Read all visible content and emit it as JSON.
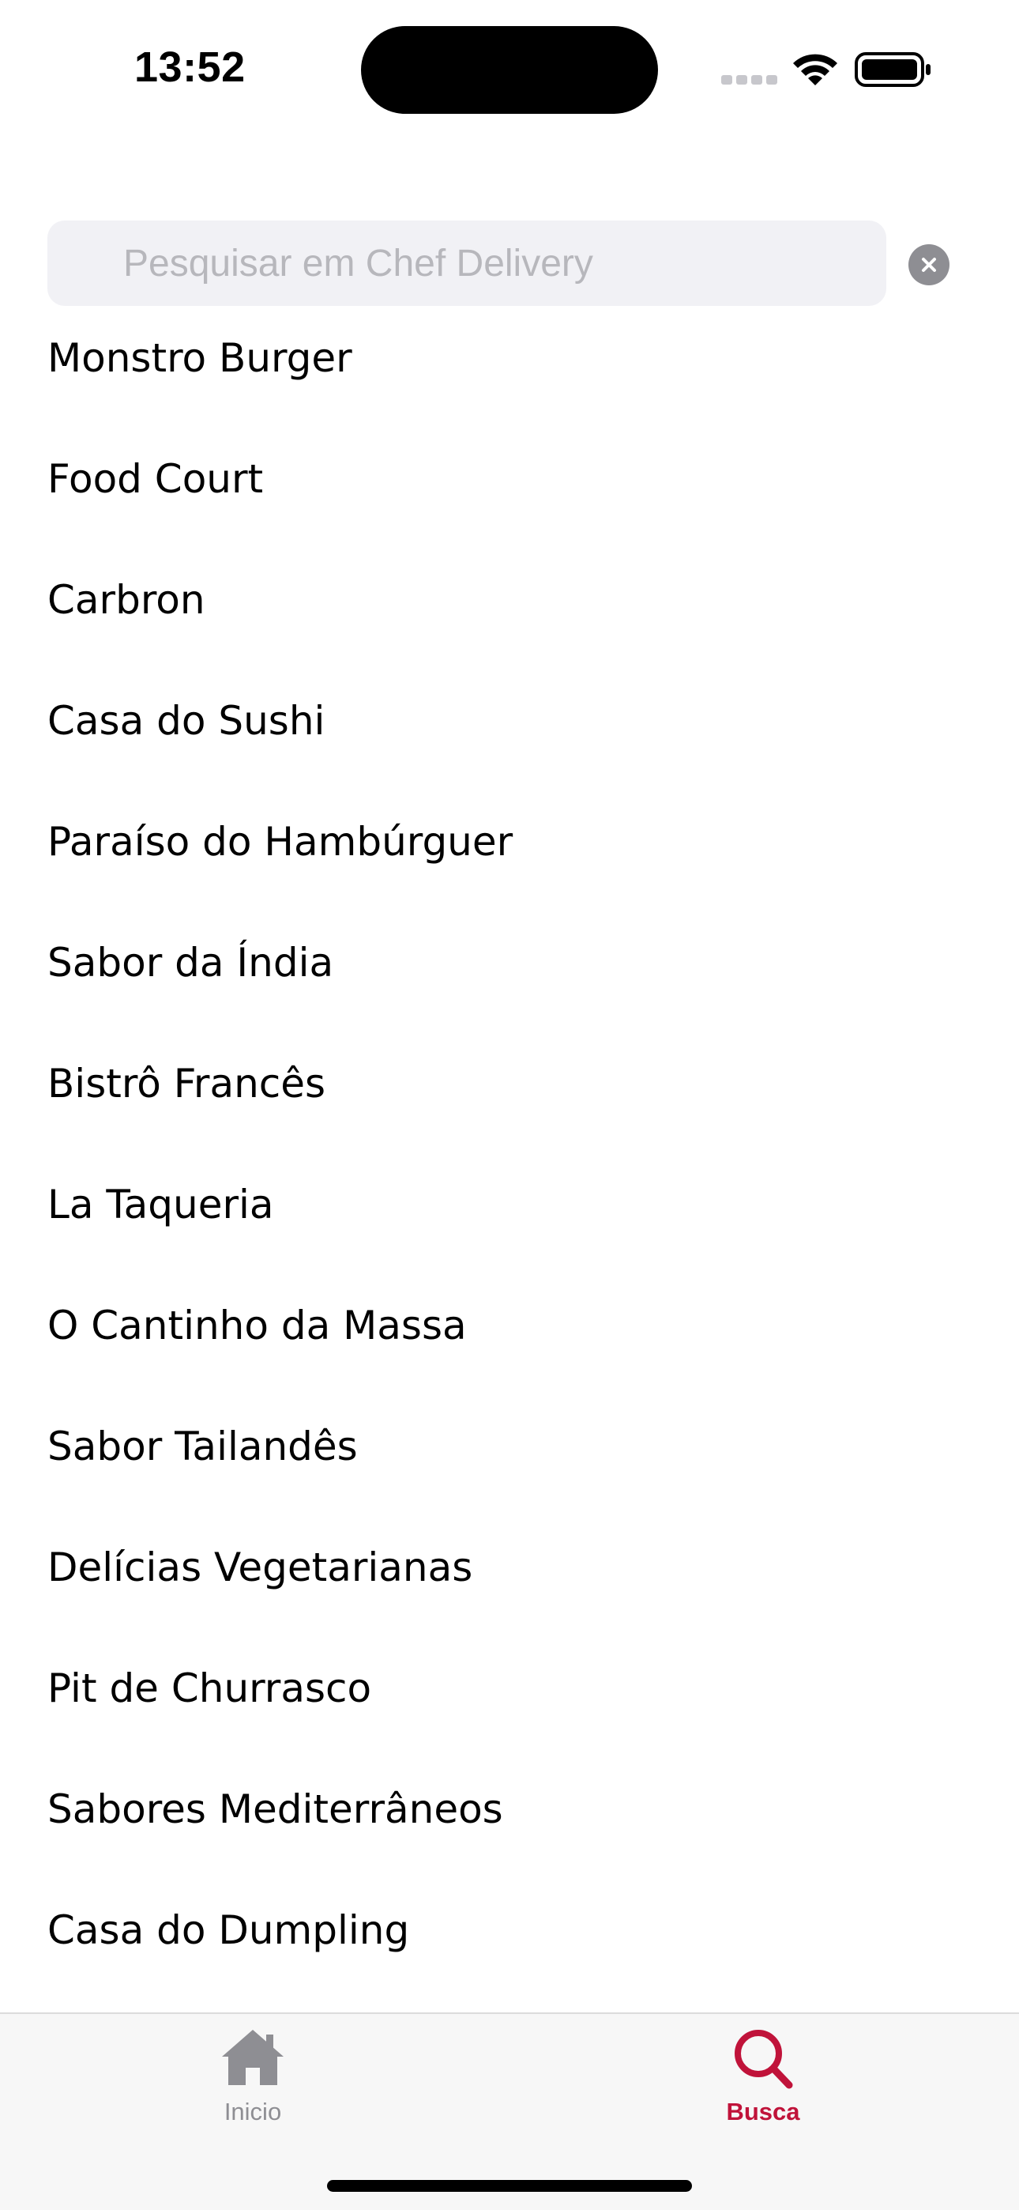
{
  "status_bar": {
    "time": "13:52"
  },
  "search": {
    "placeholder": "Pesquisar em Chef Delivery",
    "value": ""
  },
  "restaurants": [
    "Monstro Burger",
    "Food Court",
    "Carbron",
    "Casa do Sushi",
    "Paraíso do Hambúrguer",
    "Sabor da Índia",
    "Bistrô Francês",
    "La Taqueria",
    "O Cantinho da Massa",
    "Sabor Tailandês",
    "Delícias Vegetarianas",
    "Pit de Churrasco",
    "Sabores Mediterrâneos",
    "Casa do Dumpling"
  ],
  "tab_bar": {
    "home": {
      "label": "Inicio",
      "icon": "house-icon"
    },
    "search": {
      "label": "Busca",
      "icon": "magnifying-glass-icon",
      "selected": true
    }
  },
  "colors": {
    "accent": "#c0133a",
    "inactive_tab": "#8e8e93",
    "search_background": "#f1f1f5",
    "placeholder": "#b7b7bc"
  }
}
